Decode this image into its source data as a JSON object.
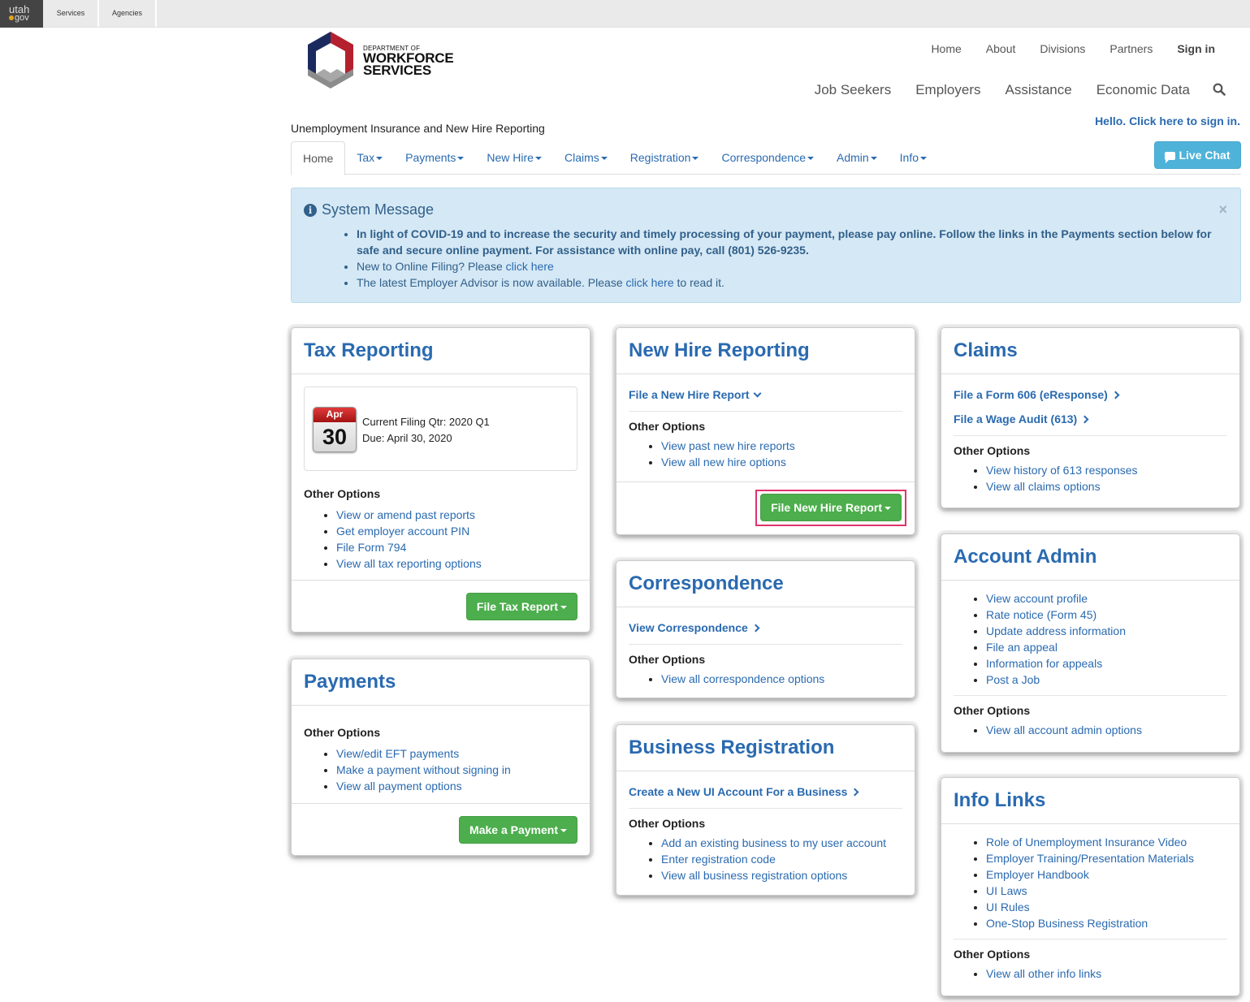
{
  "utah_bar": {
    "logo_top": "utah",
    "logo_bottom": "gov",
    "tabs": [
      "Services",
      "Agencies"
    ]
  },
  "brand": {
    "line1": "DEPARTMENT OF",
    "line2": "WORKFORCE",
    "line3": "SERVICES",
    "colors": {
      "navy": "#1b2a5e",
      "red": "#b5202e",
      "gray": "#8c8c8c"
    }
  },
  "util_nav": [
    "Home",
    "About",
    "Divisions",
    "Partners",
    "Sign in"
  ],
  "main_nav": [
    "Job Seekers",
    "Employers",
    "Assistance",
    "Economic Data"
  ],
  "app_title": "Unemployment Insurance and New Hire Reporting",
  "hello_link": "Hello. Click here to sign in.",
  "live_chat": "Live Chat",
  "tabs": [
    {
      "label": "Home",
      "active": true
    },
    {
      "label": "Tax"
    },
    {
      "label": "Payments"
    },
    {
      "label": "New Hire"
    },
    {
      "label": "Claims"
    },
    {
      "label": "Registration"
    },
    {
      "label": "Correspondence"
    },
    {
      "label": "Admin"
    },
    {
      "label": "Info"
    }
  ],
  "system_message": {
    "title": "System Message",
    "close": "×",
    "items": [
      "In light of COVID-19 and to increase the security and timely processing of your payment, please pay online. Follow the links in the Payments section below for safe and secure online payment. For assistance with online pay, call (801) 526-9235.",
      {
        "prefix": "New to Online Filing? Please ",
        "link": "click here",
        "suffix": ""
      },
      {
        "prefix": "The latest Employer Advisor is now available. Please ",
        "link": "click here",
        "suffix": " to read it."
      }
    ]
  },
  "panels": {
    "tax": {
      "title": "Tax Reporting",
      "calendar": {
        "month": "Apr",
        "day": "30"
      },
      "filing_qtr": "Current Filing Qtr: 2020 Q1",
      "due": "Due: April 30, 2020",
      "other_options": "Other Options",
      "links": [
        "View or amend past reports",
        "Get employer account PIN",
        "File Form 794",
        "View all tax reporting options"
      ],
      "button": "File Tax Report"
    },
    "payments": {
      "title": "Payments",
      "other_options": "Other Options",
      "links": [
        "View/edit EFT payments",
        "Make a payment without signing in",
        "View all payment options"
      ],
      "button": "Make a Payment"
    },
    "newhire": {
      "title": "New Hire Reporting",
      "primary": "File a New Hire Report",
      "other_options": "Other Options",
      "links": [
        "View past new hire reports",
        "View all new hire options"
      ],
      "button": "File New Hire Report"
    },
    "correspondence": {
      "title": "Correspondence",
      "primary": "View Correspondence",
      "other_options": "Other Options",
      "links": [
        "View all correspondence options"
      ]
    },
    "registration": {
      "title": "Business Registration",
      "primary": "Create a New UI Account For a Business",
      "other_options": "Other Options",
      "links": [
        "Add an existing business to my user account",
        "Enter registration code",
        "View all business registration options"
      ]
    },
    "claims": {
      "title": "Claims",
      "primary": [
        "File a Form 606 (eResponse)",
        "File a Wage Audit (613)"
      ],
      "other_options": "Other Options",
      "links": [
        "View history of 613 responses",
        "View all claims options"
      ]
    },
    "admin": {
      "title": "Account Admin",
      "main_links": [
        "View account profile",
        "Rate notice (Form 45)",
        "Update address information",
        "File an appeal",
        "Information for appeals",
        "Post a Job"
      ],
      "other_options": "Other Options",
      "links": [
        "View all account admin options"
      ]
    },
    "info": {
      "title": "Info Links",
      "main_links": [
        "Role of Unemployment Insurance Video",
        "Employer Training/Presentation Materials",
        "Employer Handbook",
        "UI Laws",
        "UI Rules",
        "One-Stop Business Registration"
      ],
      "other_options": "Other Options",
      "links": [
        "View all other info links"
      ]
    }
  },
  "colors": {
    "link": "#2a6ab0",
    "button_green": "#4cae4c",
    "live_chat": "#4fb3d9",
    "alert_bg": "#d5e8f5",
    "highlight": "#e0336b"
  }
}
